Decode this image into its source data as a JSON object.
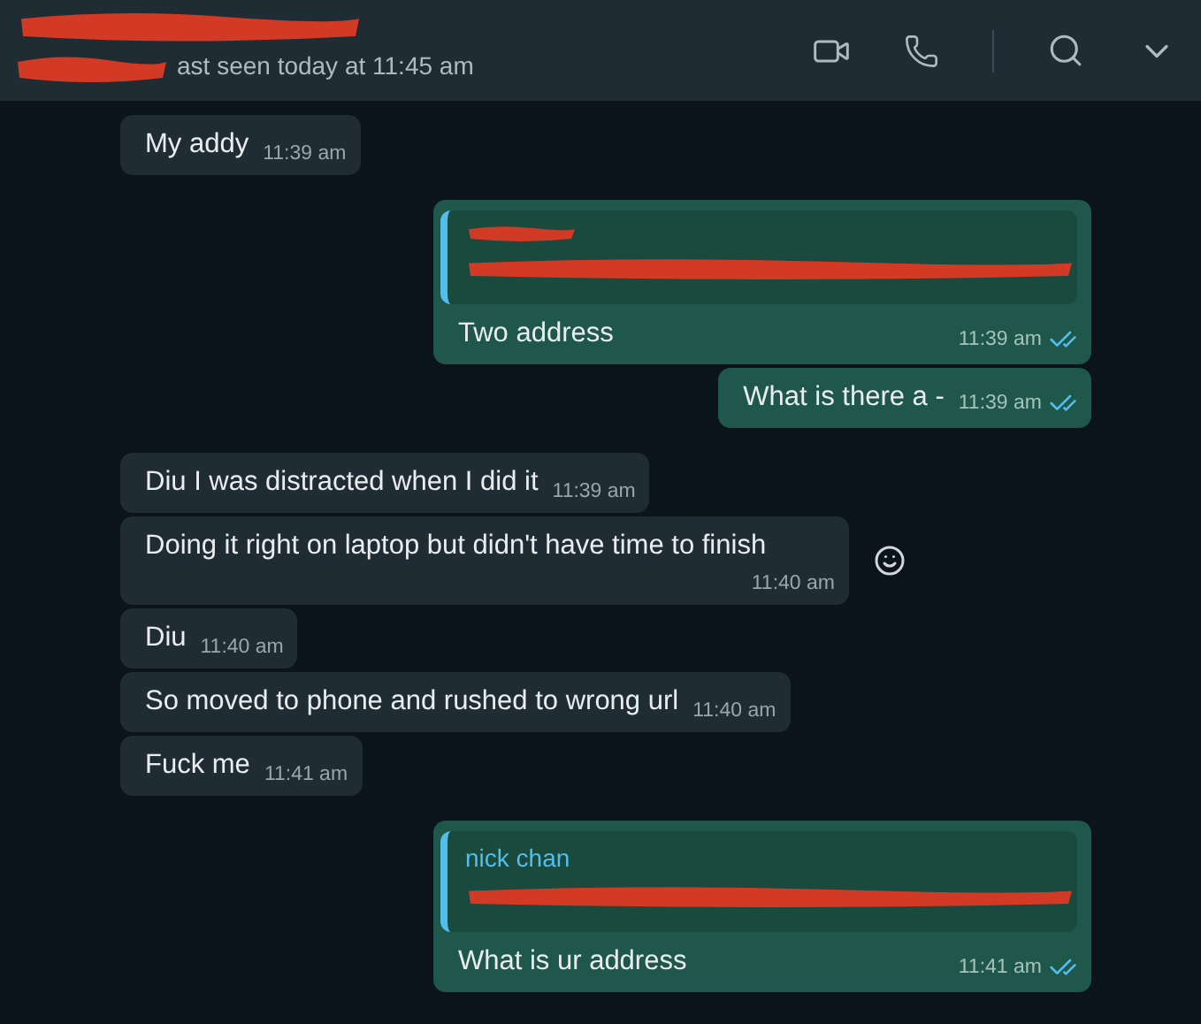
{
  "header": {
    "status": "ast seen today at 11:45 am",
    "name_redacted": true
  },
  "messages": [
    {
      "kind": "in",
      "text": "My addy",
      "time": "11:39 am"
    },
    {
      "kind": "out",
      "text": "Two address",
      "time": "11:39 am",
      "read": true,
      "quote": {
        "author_redacted": true
      }
    },
    {
      "kind": "out",
      "text": "What is there a -",
      "time": "11:39 am",
      "read": true
    },
    {
      "kind": "in",
      "text": "Diu I was distracted when I did it",
      "time": "11:39 am"
    },
    {
      "kind": "in",
      "text": "Doing it right on laptop but didn't have time to finish",
      "time": "11:40 am",
      "reaction_button": true
    },
    {
      "kind": "in",
      "text": "Diu",
      "time": "11:40 am"
    },
    {
      "kind": "in",
      "text": "So moved to phone and rushed to wrong url",
      "time": "11:40 am"
    },
    {
      "kind": "in",
      "text": "Fuck me",
      "time": "11:41 am"
    },
    {
      "kind": "out",
      "text": "What is ur address",
      "time": "11:41 am",
      "read": true,
      "quote": {
        "author": "nick chan"
      }
    }
  ]
}
